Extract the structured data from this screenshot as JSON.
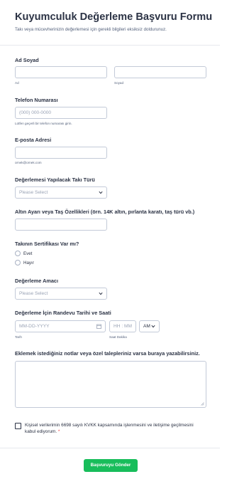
{
  "header": {
    "title": "Kuyumculuk Değerleme Başvuru Formu",
    "subtitle": "Takı veya mücevherinizin değerlemesi için gerekli bilgileri eksiksiz doldurunuz."
  },
  "name": {
    "label": "Ad Soyad",
    "first_sublabel": "Ad",
    "last_sublabel": "Soyad",
    "first_value": "",
    "last_value": ""
  },
  "phone": {
    "label": "Telefon Numarası",
    "placeholder": "(000) 000-0000",
    "hint": "Lütfen geçerli bir telefon numarası girin."
  },
  "email": {
    "label": "E-posta Adresi",
    "value": "",
    "hint": "ornek@ornek.com"
  },
  "jewelry_type": {
    "label": "Değerlemesi Yapılacak Takı Türü",
    "selected": "Please Select"
  },
  "gold_details": {
    "label": "Altın Ayarı veya Taş Özellikleri (örn. 14K altın, pırlanta karatı, taş türü vb.)",
    "value": ""
  },
  "certificate": {
    "label": "Takının Sertifikası Var mı?",
    "options": [
      "Evet",
      "Hayır"
    ]
  },
  "purpose": {
    "label": "Değerleme Amacı",
    "selected": "Please Select"
  },
  "appointment": {
    "label": "Değerleme İçin Randevu Tarihi ve Saati",
    "date_placeholder": "MM-DD-YYYY",
    "time_placeholder": "HH : MM",
    "ampm": "AM",
    "date_sublabel": "Tarih",
    "time_sublabel": "Saat Dakika"
  },
  "notes": {
    "label": "Eklemek istediğiniz notlar veya özel talepleriniz varsa buraya yazabilirsiniz.",
    "value": ""
  },
  "consent": {
    "text": "Kişisel verilerimin 6698 sayılı KVKK kapsamında işlenmesini ve iletişime geçilmesini kabul ediyorum.",
    "required_mark": "*"
  },
  "submit": {
    "label": "Başvuruyu Gönder"
  },
  "colors": {
    "accent": "#18bd5b",
    "border": "#c3cad8",
    "text": "#2c3345",
    "required": "#f23a3c"
  }
}
